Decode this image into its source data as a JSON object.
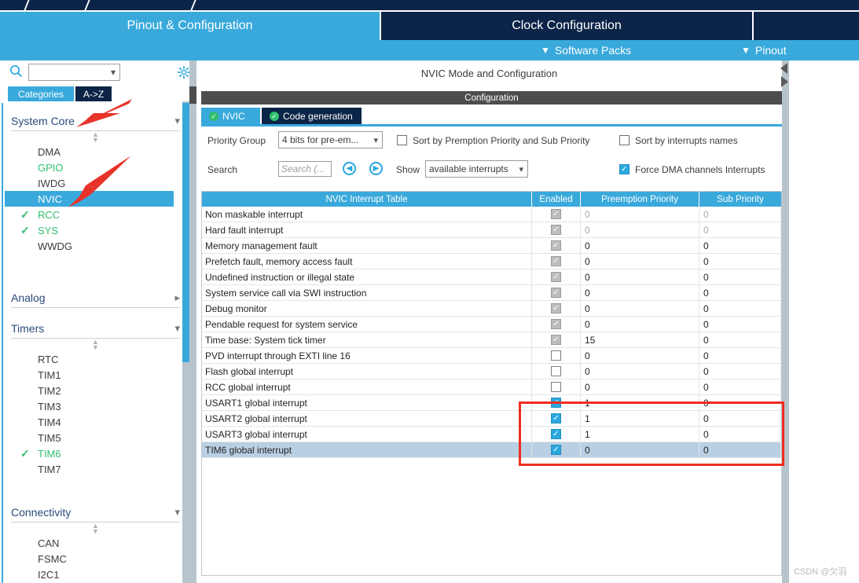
{
  "colors": {
    "accent_blue": "#39a9dc",
    "dark_navy": "#0b2447",
    "green_check": "#2fbf6e",
    "red_highlight": "#ef2d20",
    "selected_row": "#b9cfe3",
    "header_grey": "#4d4d4d"
  },
  "main_tabs": [
    {
      "label": "Pinout & Configuration",
      "active": true
    },
    {
      "label": "Clock Configuration",
      "active": false
    },
    {
      "label": "",
      "active": false
    }
  ],
  "sub_bar": [
    {
      "label": "Software Packs",
      "chevron": "chevron-down-icon"
    },
    {
      "label": "Pinout",
      "chevron": "chevron-down-icon"
    }
  ],
  "left_panel": {
    "search": {
      "value": "",
      "placeholder": ""
    },
    "search_icon": "search-icon",
    "gear_icon": "gear-icon",
    "view_buttons": [
      {
        "label": "Categories",
        "selected": true
      },
      {
        "label": "A->Z",
        "selected": false
      }
    ],
    "groups": [
      {
        "title": "System Core",
        "expanded": true,
        "items": [
          {
            "label": "DMA",
            "state": "normal"
          },
          {
            "label": "GPIO",
            "state": "configured"
          },
          {
            "label": "IWDG",
            "state": "normal"
          },
          {
            "label": "NVIC",
            "state": "selected"
          },
          {
            "label": "RCC",
            "state": "checked"
          },
          {
            "label": "SYS",
            "state": "checked"
          },
          {
            "label": "WWDG",
            "state": "normal"
          }
        ]
      },
      {
        "title": "Analog",
        "expanded": false,
        "items": []
      },
      {
        "title": "Timers",
        "expanded": true,
        "items": [
          {
            "label": "RTC",
            "state": "normal"
          },
          {
            "label": "TIM1",
            "state": "normal"
          },
          {
            "label": "TIM2",
            "state": "normal"
          },
          {
            "label": "TIM3",
            "state": "normal"
          },
          {
            "label": "TIM4",
            "state": "normal"
          },
          {
            "label": "TIM5",
            "state": "normal"
          },
          {
            "label": "TIM6",
            "state": "checked"
          },
          {
            "label": "TIM7",
            "state": "normal"
          }
        ]
      },
      {
        "title": "Connectivity",
        "expanded": true,
        "items": [
          {
            "label": "CAN",
            "state": "normal"
          },
          {
            "label": "FSMC",
            "state": "normal"
          },
          {
            "label": "I2C1",
            "state": "normal"
          }
        ]
      }
    ]
  },
  "right_panel": {
    "mode_title": "NVIC Mode and Configuration",
    "configuration_header": "Configuration",
    "tabs": [
      {
        "label": "NVIC",
        "active": true,
        "icon": "green-check-icon"
      },
      {
        "label": "Code generation",
        "active": false,
        "icon": "green-check-icon"
      }
    ],
    "options": {
      "priority_group_label": "Priority Group",
      "priority_group_value": "4 bits for pre-em...",
      "sort_premption_label": "Sort by Premption Priority and Sub Priority",
      "sort_premption_checked": false,
      "sort_names_label": "Sort by interrupts names",
      "sort_names_checked": false,
      "search_label": "Search",
      "search_placeholder": "Search (...",
      "search_value": "",
      "prev_icon": "chevron-left-circle-icon",
      "next_icon": "chevron-right-circle-icon",
      "show_label": "Show",
      "show_value": "available interrupts",
      "force_dma_label": "Force DMA channels Interrupts",
      "force_dma_checked": true
    },
    "table": {
      "columns": [
        "NVIC Interrupt Table",
        "Enabled",
        "Preemption Priority",
        "Sub Priority"
      ],
      "rows": [
        {
          "name": "Non maskable interrupt",
          "enabled": "locked",
          "preemption": "0",
          "sub": "0",
          "dim": true,
          "selected": false
        },
        {
          "name": "Hard fault interrupt",
          "enabled": "locked",
          "preemption": "0",
          "sub": "0",
          "dim": true,
          "selected": false
        },
        {
          "name": "Memory management fault",
          "enabled": "locked",
          "preemption": "0",
          "sub": "0",
          "dim": false,
          "selected": false
        },
        {
          "name": "Prefetch fault, memory access fault",
          "enabled": "locked",
          "preemption": "0",
          "sub": "0",
          "dim": false,
          "selected": false
        },
        {
          "name": "Undefined instruction or illegal state",
          "enabled": "locked",
          "preemption": "0",
          "sub": "0",
          "dim": false,
          "selected": false
        },
        {
          "name": "System service call via SWI instruction",
          "enabled": "locked",
          "preemption": "0",
          "sub": "0",
          "dim": false,
          "selected": false
        },
        {
          "name": "Debug monitor",
          "enabled": "locked",
          "preemption": "0",
          "sub": "0",
          "dim": false,
          "selected": false
        },
        {
          "name": "Pendable request for system service",
          "enabled": "locked",
          "preemption": "0",
          "sub": "0",
          "dim": false,
          "selected": false
        },
        {
          "name": "Time base: System tick timer",
          "enabled": "locked",
          "preemption": "15",
          "sub": "0",
          "dim": false,
          "selected": false
        },
        {
          "name": "PVD interrupt through EXTI line 16",
          "enabled": "off",
          "preemption": "0",
          "sub": "0",
          "dim": false,
          "selected": false
        },
        {
          "name": "Flash global interrupt",
          "enabled": "off",
          "preemption": "0",
          "sub": "0",
          "dim": false,
          "selected": false
        },
        {
          "name": "RCC global interrupt",
          "enabled": "off",
          "preemption": "0",
          "sub": "0",
          "dim": false,
          "selected": false
        },
        {
          "name": "USART1 global interrupt",
          "enabled": "on",
          "preemption": "1",
          "sub": "0",
          "dim": false,
          "selected": false
        },
        {
          "name": "USART2 global interrupt",
          "enabled": "on",
          "preemption": "1",
          "sub": "0",
          "dim": false,
          "selected": false
        },
        {
          "name": "USART3 global interrupt",
          "enabled": "on",
          "preemption": "1",
          "sub": "0",
          "dim": false,
          "selected": false
        },
        {
          "name": "TIM6 global interrupt",
          "enabled": "on",
          "preemption": "0",
          "sub": "0",
          "dim": false,
          "selected": true
        }
      ]
    }
  },
  "watermark": "CSDN @欠羽"
}
